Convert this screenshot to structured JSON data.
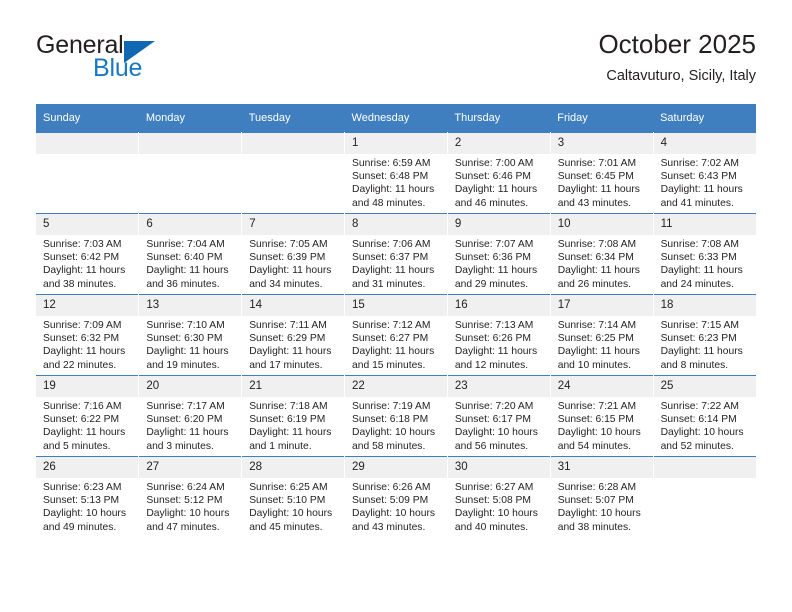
{
  "logo": {
    "word_top": "General",
    "word_bottom": "Blue",
    "triangle_color": "#1267b2",
    "blue_color": "#1779c4"
  },
  "header": {
    "title": "October 2025",
    "location": "Caltavuturo, Sicily, Italy"
  },
  "theme": {
    "header_row_bg": "#3f7fbf",
    "daynum_bg": "#f0f0f0",
    "text_color": "#231f20"
  },
  "weekday_headers": [
    "Sunday",
    "Monday",
    "Tuesday",
    "Wednesday",
    "Thursday",
    "Friday",
    "Saturday"
  ],
  "labels": {
    "sunrise_prefix": "Sunrise:",
    "sunset_prefix": "Sunset:",
    "daylight_prefix": "Daylight:"
  },
  "weeks": [
    [
      {
        "day": "",
        "empty": true
      },
      {
        "day": "",
        "empty": true
      },
      {
        "day": "",
        "empty": true
      },
      {
        "day": "1",
        "sunrise": "Sunrise: 6:59 AM",
        "sunset": "Sunset: 6:48 PM",
        "daylight1": "Daylight: 11 hours",
        "daylight2": "and 48 minutes."
      },
      {
        "day": "2",
        "sunrise": "Sunrise: 7:00 AM",
        "sunset": "Sunset: 6:46 PM",
        "daylight1": "Daylight: 11 hours",
        "daylight2": "and 46 minutes."
      },
      {
        "day": "3",
        "sunrise": "Sunrise: 7:01 AM",
        "sunset": "Sunset: 6:45 PM",
        "daylight1": "Daylight: 11 hours",
        "daylight2": "and 43 minutes."
      },
      {
        "day": "4",
        "sunrise": "Sunrise: 7:02 AM",
        "sunset": "Sunset: 6:43 PM",
        "daylight1": "Daylight: 11 hours",
        "daylight2": "and 41 minutes."
      }
    ],
    [
      {
        "day": "5",
        "sunrise": "Sunrise: 7:03 AM",
        "sunset": "Sunset: 6:42 PM",
        "daylight1": "Daylight: 11 hours",
        "daylight2": "and 38 minutes."
      },
      {
        "day": "6",
        "sunrise": "Sunrise: 7:04 AM",
        "sunset": "Sunset: 6:40 PM",
        "daylight1": "Daylight: 11 hours",
        "daylight2": "and 36 minutes."
      },
      {
        "day": "7",
        "sunrise": "Sunrise: 7:05 AM",
        "sunset": "Sunset: 6:39 PM",
        "daylight1": "Daylight: 11 hours",
        "daylight2": "and 34 minutes."
      },
      {
        "day": "8",
        "sunrise": "Sunrise: 7:06 AM",
        "sunset": "Sunset: 6:37 PM",
        "daylight1": "Daylight: 11 hours",
        "daylight2": "and 31 minutes."
      },
      {
        "day": "9",
        "sunrise": "Sunrise: 7:07 AM",
        "sunset": "Sunset: 6:36 PM",
        "daylight1": "Daylight: 11 hours",
        "daylight2": "and 29 minutes."
      },
      {
        "day": "10",
        "sunrise": "Sunrise: 7:08 AM",
        "sunset": "Sunset: 6:34 PM",
        "daylight1": "Daylight: 11 hours",
        "daylight2": "and 26 minutes."
      },
      {
        "day": "11",
        "sunrise": "Sunrise: 7:08 AM",
        "sunset": "Sunset: 6:33 PM",
        "daylight1": "Daylight: 11 hours",
        "daylight2": "and 24 minutes."
      }
    ],
    [
      {
        "day": "12",
        "sunrise": "Sunrise: 7:09 AM",
        "sunset": "Sunset: 6:32 PM",
        "daylight1": "Daylight: 11 hours",
        "daylight2": "and 22 minutes."
      },
      {
        "day": "13",
        "sunrise": "Sunrise: 7:10 AM",
        "sunset": "Sunset: 6:30 PM",
        "daylight1": "Daylight: 11 hours",
        "daylight2": "and 19 minutes."
      },
      {
        "day": "14",
        "sunrise": "Sunrise: 7:11 AM",
        "sunset": "Sunset: 6:29 PM",
        "daylight1": "Daylight: 11 hours",
        "daylight2": "and 17 minutes."
      },
      {
        "day": "15",
        "sunrise": "Sunrise: 7:12 AM",
        "sunset": "Sunset: 6:27 PM",
        "daylight1": "Daylight: 11 hours",
        "daylight2": "and 15 minutes."
      },
      {
        "day": "16",
        "sunrise": "Sunrise: 7:13 AM",
        "sunset": "Sunset: 6:26 PM",
        "daylight1": "Daylight: 11 hours",
        "daylight2": "and 12 minutes."
      },
      {
        "day": "17",
        "sunrise": "Sunrise: 7:14 AM",
        "sunset": "Sunset: 6:25 PM",
        "daylight1": "Daylight: 11 hours",
        "daylight2": "and 10 minutes."
      },
      {
        "day": "18",
        "sunrise": "Sunrise: 7:15 AM",
        "sunset": "Sunset: 6:23 PM",
        "daylight1": "Daylight: 11 hours",
        "daylight2": "and 8 minutes."
      }
    ],
    [
      {
        "day": "19",
        "sunrise": "Sunrise: 7:16 AM",
        "sunset": "Sunset: 6:22 PM",
        "daylight1": "Daylight: 11 hours",
        "daylight2": "and 5 minutes."
      },
      {
        "day": "20",
        "sunrise": "Sunrise: 7:17 AM",
        "sunset": "Sunset: 6:20 PM",
        "daylight1": "Daylight: 11 hours",
        "daylight2": "and 3 minutes."
      },
      {
        "day": "21",
        "sunrise": "Sunrise: 7:18 AM",
        "sunset": "Sunset: 6:19 PM",
        "daylight1": "Daylight: 11 hours",
        "daylight2": "and 1 minute."
      },
      {
        "day": "22",
        "sunrise": "Sunrise: 7:19 AM",
        "sunset": "Sunset: 6:18 PM",
        "daylight1": "Daylight: 10 hours",
        "daylight2": "and 58 minutes."
      },
      {
        "day": "23",
        "sunrise": "Sunrise: 7:20 AM",
        "sunset": "Sunset: 6:17 PM",
        "daylight1": "Daylight: 10 hours",
        "daylight2": "and 56 minutes."
      },
      {
        "day": "24",
        "sunrise": "Sunrise: 7:21 AM",
        "sunset": "Sunset: 6:15 PM",
        "daylight1": "Daylight: 10 hours",
        "daylight2": "and 54 minutes."
      },
      {
        "day": "25",
        "sunrise": "Sunrise: 7:22 AM",
        "sunset": "Sunset: 6:14 PM",
        "daylight1": "Daylight: 10 hours",
        "daylight2": "and 52 minutes."
      }
    ],
    [
      {
        "day": "26",
        "sunrise": "Sunrise: 6:23 AM",
        "sunset": "Sunset: 5:13 PM",
        "daylight1": "Daylight: 10 hours",
        "daylight2": "and 49 minutes."
      },
      {
        "day": "27",
        "sunrise": "Sunrise: 6:24 AM",
        "sunset": "Sunset: 5:12 PM",
        "daylight1": "Daylight: 10 hours",
        "daylight2": "and 47 minutes."
      },
      {
        "day": "28",
        "sunrise": "Sunrise: 6:25 AM",
        "sunset": "Sunset: 5:10 PM",
        "daylight1": "Daylight: 10 hours",
        "daylight2": "and 45 minutes."
      },
      {
        "day": "29",
        "sunrise": "Sunrise: 6:26 AM",
        "sunset": "Sunset: 5:09 PM",
        "daylight1": "Daylight: 10 hours",
        "daylight2": "and 43 minutes."
      },
      {
        "day": "30",
        "sunrise": "Sunrise: 6:27 AM",
        "sunset": "Sunset: 5:08 PM",
        "daylight1": "Daylight: 10 hours",
        "daylight2": "and 40 minutes."
      },
      {
        "day": "31",
        "sunrise": "Sunrise: 6:28 AM",
        "sunset": "Sunset: 5:07 PM",
        "daylight1": "Daylight: 10 hours",
        "daylight2": "and 38 minutes."
      },
      {
        "day": "",
        "empty": true
      }
    ]
  ]
}
